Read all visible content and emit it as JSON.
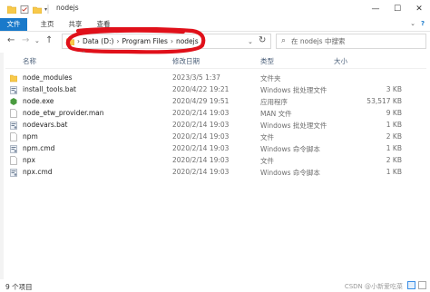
{
  "window": {
    "title": "nodejs",
    "controls": {
      "minimize": "—",
      "maximize": "☐",
      "close": "✕"
    }
  },
  "ribbon": {
    "tabs": [
      {
        "label": "文件",
        "active": true
      },
      {
        "label": "主页"
      },
      {
        "label": "共享"
      },
      {
        "label": "查看"
      }
    ],
    "collapse_glyph": "⌄",
    "help_glyph": "?"
  },
  "address": {
    "back": "←",
    "forward": "→",
    "recent": "⌄",
    "up": "↑",
    "crumbs": [
      "Data (D:)",
      "Program Files",
      "nodejs"
    ],
    "separator": "›",
    "dropdown": "⌄",
    "refresh": "↻"
  },
  "search": {
    "placeholder": "在 nodejs 中搜索",
    "icon": "search-icon"
  },
  "columns": {
    "name": "名称",
    "date": "修改日期",
    "type": "类型",
    "size": "大小"
  },
  "files": [
    {
      "name": "node_modules",
      "date": "2023/3/5 1:37",
      "type": "文件夹",
      "size": "",
      "icon": "folder-icon"
    },
    {
      "name": "install_tools.bat",
      "date": "2020/4/22 19:21",
      "type": "Windows 批处理文件",
      "size": "3 KB",
      "icon": "bat-file-icon"
    },
    {
      "name": "node.exe",
      "date": "2020/4/29 19:51",
      "type": "应用程序",
      "size": "53,517 KB",
      "icon": "node-exe-icon"
    },
    {
      "name": "node_etw_provider.man",
      "date": "2020/2/14 19:03",
      "type": "MAN 文件",
      "size": "9 KB",
      "icon": "file-icon"
    },
    {
      "name": "nodevars.bat",
      "date": "2020/2/14 19:03",
      "type": "Windows 批处理文件",
      "size": "1 KB",
      "icon": "bat-file-icon"
    },
    {
      "name": "npm",
      "date": "2020/2/14 19:03",
      "type": "文件",
      "size": "2 KB",
      "icon": "file-icon"
    },
    {
      "name": "npm.cmd",
      "date": "2020/2/14 19:03",
      "type": "Windows 命令脚本",
      "size": "1 KB",
      "icon": "cmd-file-icon"
    },
    {
      "name": "npx",
      "date": "2020/2/14 19:03",
      "type": "文件",
      "size": "2 KB",
      "icon": "file-icon"
    },
    {
      "name": "npx.cmd",
      "date": "2020/2/14 19:03",
      "type": "Windows 命令脚本",
      "size": "1 KB",
      "icon": "cmd-file-icon"
    }
  ],
  "status": {
    "count": "9 个项目"
  },
  "watermark": "CSDN @小新爱吃菜",
  "colors": {
    "accent": "#1979ca",
    "marker": "#e0101a",
    "folder": "#f8c94a",
    "node_green": "#4a9b3f"
  }
}
